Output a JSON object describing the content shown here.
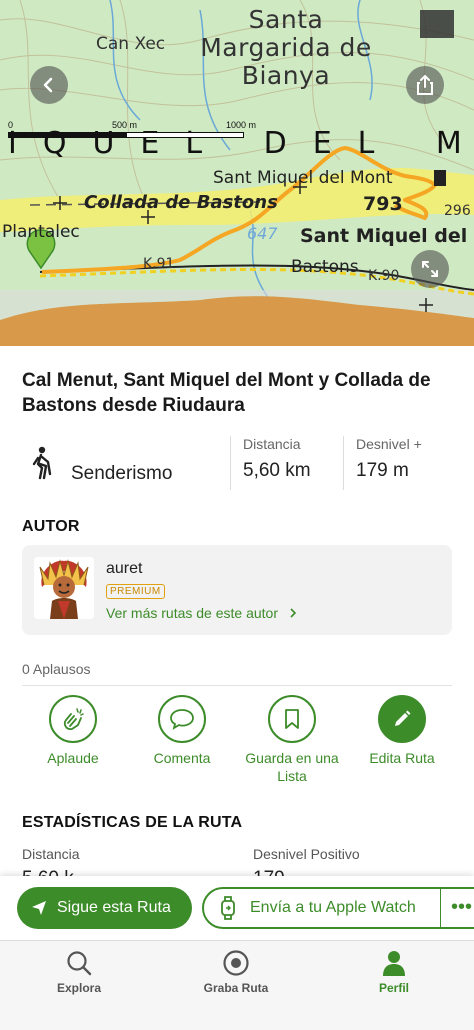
{
  "map": {
    "labels": {
      "town": "Santa Margarida de Bianya",
      "hamlet_north": "Can Xec",
      "peak_range": "IQUEL DEL M",
      "peak_name_small": "Sant Miquel del Mont",
      "elevation": "793",
      "elevation_right": "296",
      "peak_name_big": "Sant Miquel del",
      "collada": "Collada de Bastons",
      "plantalec": "Plantalec",
      "bastons": "Bastons",
      "k91": "K.91",
      "k90": "K.90",
      "water": "647"
    },
    "scale": {
      "t0": "0",
      "t500": "500 m",
      "t1000": "1000 m"
    },
    "buttons": {
      "back_icon": "chevron-left-icon",
      "share_icon": "share-icon",
      "expand_icon": "expand-icon"
    }
  },
  "route": {
    "title": "Cal Menut, Sant Miquel del Mont y Collada de Bastons desde Riudaura",
    "activity": "Senderismo",
    "distance_label": "Distancia",
    "distance_value": "5,60 km",
    "elevation_label": "Desnivel +",
    "elevation_value": "179 m"
  },
  "author": {
    "section_title": "AUTOR",
    "name": "auret",
    "badge": "PREMIUM",
    "link": "Ver más rutas de este autor"
  },
  "social": {
    "applause_count": "0 Aplausos",
    "actions": [
      {
        "label": "Aplaude",
        "icon": "clap-icon"
      },
      {
        "label": "Comenta",
        "icon": "comment-icon"
      },
      {
        "label": "Guarda en una Lista",
        "icon": "bookmark-icon"
      },
      {
        "label": "Edita Ruta",
        "icon": "pencil-icon"
      }
    ]
  },
  "stats": {
    "section_title": "ESTADÍSTICAS DE LA RUTA",
    "distance_label": "Distancia",
    "distance_value_partial": "5,60 k",
    "elevation_label": "Desnivel Positivo",
    "elevation_value_partial": "179"
  },
  "action_bar": {
    "follow": "Sigue esta Ruta",
    "watch": "Envía a tu Apple Watch",
    "more": "•••"
  },
  "tabs": [
    {
      "label": "Explora",
      "icon": "search-icon",
      "active": false
    },
    {
      "label": "Graba Ruta",
      "icon": "record-icon",
      "active": false
    },
    {
      "label": "Perfil",
      "icon": "user-icon",
      "active": true
    }
  ],
  "colors": {
    "accent": "#3d8c2a",
    "route": "#f5a623",
    "premium": "#c98a00"
  }
}
